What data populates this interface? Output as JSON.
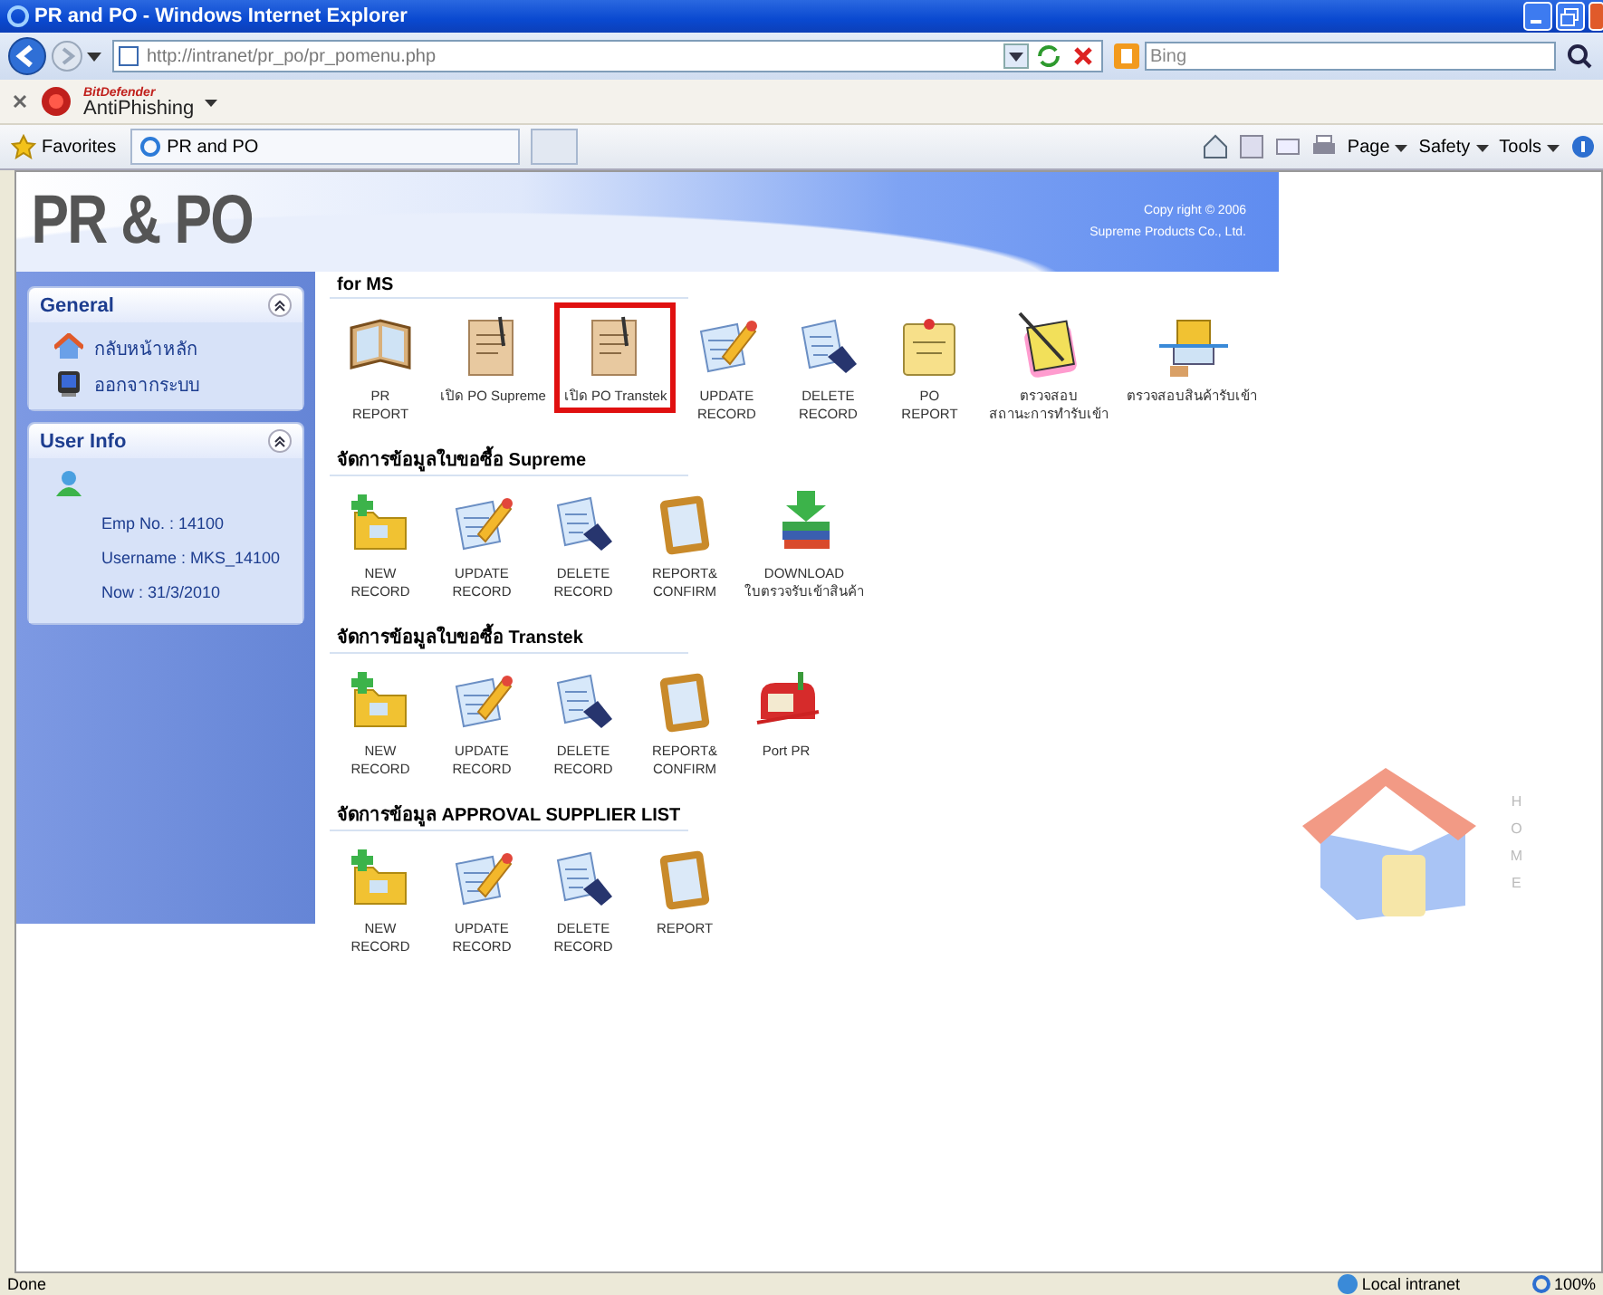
{
  "window": {
    "title": "PR and PO - Windows Internet Explorer"
  },
  "browser": {
    "address": "http://intranet/pr_po/pr_pomenu.php",
    "search_placeholder": "Bing",
    "toolbar_brand": "BitDefender",
    "toolbar_name": "AntiPhishing",
    "favorites": "Favorites",
    "tab": "PR and PO",
    "commands": [
      "Page",
      "Safety",
      "Tools"
    ]
  },
  "header": {
    "logo": "PR & PO",
    "copyright": "Copy right © 2006",
    "company": "Supreme Products Co., Ltd."
  },
  "sidebar": {
    "panels": [
      {
        "title": "General",
        "items": [
          {
            "kind": "house",
            "label": "กลับหน้าหลัก"
          },
          {
            "kind": "monitor",
            "label": "ออกจากระบบ"
          }
        ]
      },
      {
        "title": "User Info",
        "fields": [
          "Emp No. :  14100",
          "Username :  MKS_14100",
          "Now :  31/3/2010"
        ]
      }
    ]
  },
  "sections": [
    {
      "title": "for MS",
      "items": [
        {
          "kind": "book",
          "label": "PR\nREPORT",
          "highlighted": false
        },
        {
          "kind": "paper",
          "label": "เปิด PO Supreme",
          "highlighted": false
        },
        {
          "kind": "paper",
          "label": "เปิด PO Transtek",
          "highlighted": true
        },
        {
          "kind": "edit",
          "label": "UPDATE\nRECORD",
          "highlighted": false
        },
        {
          "kind": "delete",
          "label": "DELETE\nRECORD",
          "highlighted": false
        },
        {
          "kind": "note",
          "label": "PO\nREPORT",
          "highlighted": false
        },
        {
          "kind": "checklist",
          "label": "ตรวจสอบ\nสถานะการทำรับเข้า",
          "highlighted": false
        },
        {
          "kind": "scanner",
          "label": "ตรวจสอบสินค้ารับเข้า",
          "highlighted": false
        }
      ]
    },
    {
      "title": "จัดการข้อมูลใบขอซื้อ Supreme",
      "items": [
        {
          "kind": "folder",
          "label": "NEW\nRECORD"
        },
        {
          "kind": "edit",
          "label": "UPDATE\nRECORD"
        },
        {
          "kind": "delete",
          "label": "DELETE\nRECORD"
        },
        {
          "kind": "clipboard",
          "label": "REPORT&\nCONFIRM"
        },
        {
          "kind": "download",
          "label": "DOWNLOAD\nใบตรวจรับเข้าสินค้า"
        }
      ]
    },
    {
      "title": "จัดการข้อมูลใบขอซื้อ Transtek",
      "items": [
        {
          "kind": "folder",
          "label": "NEW\nRECORD"
        },
        {
          "kind": "edit",
          "label": "UPDATE\nRECORD"
        },
        {
          "kind": "delete",
          "label": "DELETE\nRECORD"
        },
        {
          "kind": "clipboard",
          "label": "REPORT&\nCONFIRM"
        },
        {
          "kind": "mailbox",
          "label": "Port PR"
        }
      ]
    },
    {
      "title": "จัดการข้อมูล APPROVAL SUPPLIER LIST",
      "items": [
        {
          "kind": "folder",
          "label": "NEW\nRECORD"
        },
        {
          "kind": "edit",
          "label": "UPDATE\nRECORD"
        },
        {
          "kind": "delete",
          "label": "DELETE\nRECORD"
        },
        {
          "kind": "clipboard",
          "label": "REPORT"
        }
      ]
    }
  ],
  "home": {
    "label": "HOME"
  },
  "status_bar": {
    "text": "Done",
    "zone": "Local intranet",
    "zoom": "100%"
  }
}
